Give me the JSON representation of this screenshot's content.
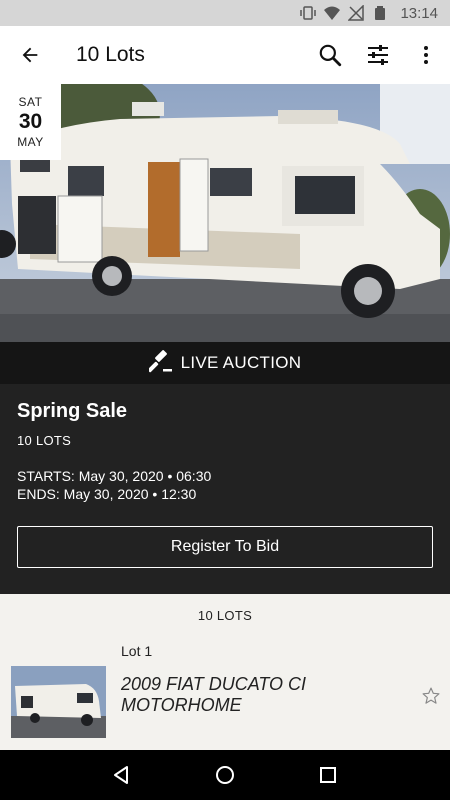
{
  "status_bar": {
    "time": "13:14"
  },
  "app_bar": {
    "title": "10 Lots",
    "icons": [
      "back-arrow-icon",
      "search-icon",
      "filter-sliders-icon",
      "more-vert-icon"
    ]
  },
  "date_badge": {
    "day_of_week": "SAT",
    "day": "30",
    "month": "MAY"
  },
  "live_banner": {
    "label": "LIVE AUCTION",
    "icon": "gavel-icon"
  },
  "sale": {
    "name": "Spring Sale",
    "lot_count": "10 LOTS",
    "starts": "STARTS: May 30, 2020 • 06:30",
    "ends": "ENDS: May 30, 2020 • 12:30",
    "register_label": "Register To Bid"
  },
  "lots": {
    "header": "10 LOTS",
    "items": [
      {
        "number": "Lot 1",
        "title": "2009 FIAT DUCATO CI MOTORHOME"
      }
    ]
  },
  "nav_bar": {
    "icons": [
      "back-triangle-icon",
      "home-circle-icon",
      "recents-square-icon"
    ]
  },
  "colors": {
    "panel": "#222222",
    "live_strip": "#151515",
    "lots_bg": "#f3f2ee"
  }
}
